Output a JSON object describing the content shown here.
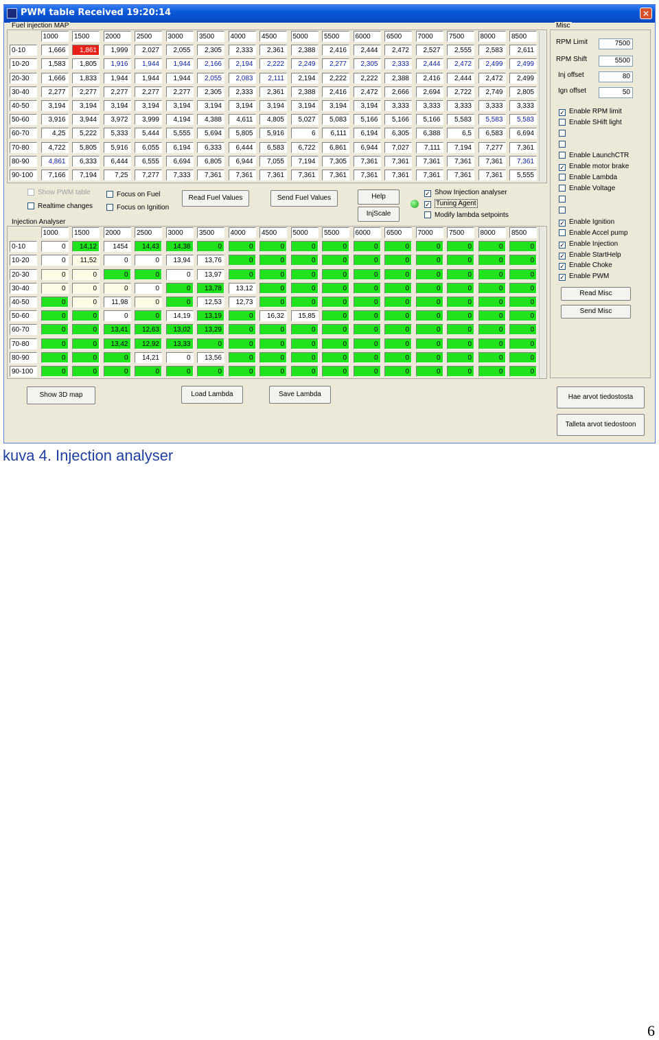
{
  "window": {
    "title": "PWM table Received 19:20:14"
  },
  "fuel_map": {
    "label": "Fuel injection MAP",
    "columns": [
      "1000",
      "1500",
      "2000",
      "2500",
      "3000",
      "3500",
      "4000",
      "4500",
      "5000",
      "5500",
      "6000",
      "6500",
      "7000",
      "7500",
      "8000",
      "8500"
    ],
    "rows": [
      {
        "label": "0-10",
        "values": [
          "1,666",
          "1,861",
          "1,999",
          "2,027",
          "2,055",
          "2,305",
          "2,333",
          "2,361",
          "2,388",
          "2,416",
          "2,444",
          "2,472",
          "2,527",
          "2,555",
          "2,583",
          "2,611"
        ],
        "red": [
          1
        ],
        "blue": []
      },
      {
        "label": "10-20",
        "values": [
          "1,583",
          "1,805",
          "1,916",
          "1,944",
          "1,944",
          "2,166",
          "2,194",
          "2,222",
          "2,249",
          "2,277",
          "2,305",
          "2,333",
          "2,444",
          "2,472",
          "2,499",
          "2,499"
        ],
        "red": [],
        "blue": [
          2,
          3,
          4,
          5,
          6,
          7,
          8,
          9,
          10,
          11,
          12,
          13,
          14,
          15
        ]
      },
      {
        "label": "20-30",
        "values": [
          "1,666",
          "1,833",
          "1,944",
          "1,944",
          "1,944",
          "2,055",
          "2,083",
          "2,111",
          "2,194",
          "2,222",
          "2,222",
          "2,388",
          "2,416",
          "2,444",
          "2,472",
          "2,499"
        ],
        "red": [],
        "blue": [
          5,
          6,
          7
        ]
      },
      {
        "label": "30-40",
        "values": [
          "2,277",
          "2,277",
          "2,277",
          "2,277",
          "2,277",
          "2,305",
          "2,333",
          "2,361",
          "2,388",
          "2,416",
          "2,472",
          "2,666",
          "2,694",
          "2,722",
          "2,749",
          "2,805"
        ],
        "red": [],
        "blue": []
      },
      {
        "label": "40-50",
        "values": [
          "3,194",
          "3,194",
          "3,194",
          "3,194",
          "3,194",
          "3,194",
          "3,194",
          "3,194",
          "3,194",
          "3,194",
          "3,194",
          "3,333",
          "3,333",
          "3,333",
          "3,333",
          "3,333"
        ],
        "red": [],
        "blue": []
      },
      {
        "label": "50-60",
        "values": [
          "3,916",
          "3,944",
          "3,972",
          "3,999",
          "4,194",
          "4,388",
          "4,611",
          "4,805",
          "5,027",
          "5,083",
          "5,166",
          "5,166",
          "5,166",
          "5,583",
          "5,583",
          "5,583"
        ],
        "red": [],
        "blue": [
          14,
          15
        ]
      },
      {
        "label": "60-70",
        "values": [
          "4,25",
          "5,222",
          "5,333",
          "5,444",
          "5,555",
          "5,694",
          "5,805",
          "5,916",
          "6",
          "6,111",
          "6,194",
          "6,305",
          "6,388",
          "6,5",
          "6,583",
          "6,694"
        ],
        "red": [],
        "blue": []
      },
      {
        "label": "70-80",
        "values": [
          "4,722",
          "5,805",
          "5,916",
          "6,055",
          "6,194",
          "6,333",
          "6,444",
          "6,583",
          "6,722",
          "6,861",
          "6,944",
          "7,027",
          "7,111",
          "7,194",
          "7,277",
          "7,361"
        ],
        "red": [],
        "blue": []
      },
      {
        "label": "80-90",
        "values": [
          "4,861",
          "6,333",
          "6,444",
          "6,555",
          "6,694",
          "6,805",
          "6,944",
          "7,055",
          "7,194",
          "7,305",
          "7,361",
          "7,361",
          "7,361",
          "7,361",
          "7,361",
          "7,361"
        ],
        "red": [],
        "blue": [
          0,
          15
        ]
      },
      {
        "label": "90-100",
        "values": [
          "7,166",
          "7,194",
          "7,25",
          "7,277",
          "7,333",
          "7,361",
          "7,361",
          "7,361",
          "7,361",
          "7,361",
          "7,361",
          "7,361",
          "7,361",
          "7,361",
          "7,361",
          "5,555"
        ],
        "red": [],
        "blue": []
      }
    ]
  },
  "options": {
    "show_pwm_table": "Show PWM table",
    "realtime_changes": "Realtime changes",
    "focus_on_fuel": "Focus on Fuel",
    "focus_on_ignition": "Focus on Ignition",
    "read_fuel_values": "Read Fuel Values",
    "send_fuel_values": "Send Fuel Values",
    "help": "Help",
    "injscale": "InjScale",
    "show_injection_analyser": "Show Injection analyser",
    "tuning_agent": "Tuning Agent",
    "modify_lambda": "Modify lambda setpoints"
  },
  "analyser": {
    "label": "Injection Analyser",
    "columns": [
      "1000",
      "1500",
      "2000",
      "2500",
      "3000",
      "3500",
      "4000",
      "4500",
      "5000",
      "5500",
      "6000",
      "6500",
      "7000",
      "7500",
      "8000",
      "8500"
    ],
    "rows": [
      {
        "label": "0-10",
        "values": [
          "0",
          "14,12",
          "1454",
          "14,43",
          "14,38",
          "0",
          "0",
          "0",
          "0",
          "0",
          "0",
          "0",
          "0",
          "0",
          "0",
          "0"
        ],
        "colors": [
          "w",
          "g",
          "w",
          "g",
          "g",
          "g",
          "g",
          "g",
          "g",
          "g",
          "g",
          "g",
          "g",
          "g",
          "g",
          "g"
        ]
      },
      {
        "label": "10-20",
        "values": [
          "0",
          "11,52",
          "0",
          "0",
          "13,94",
          "13,76",
          "0",
          "0",
          "0",
          "0",
          "0",
          "0",
          "0",
          "0",
          "0",
          "0"
        ],
        "colors": [
          "w",
          "p",
          "w",
          "w",
          "w",
          "w",
          "g",
          "g",
          "g",
          "g",
          "g",
          "g",
          "g",
          "g",
          "g",
          "g"
        ]
      },
      {
        "label": "20-30",
        "values": [
          "0",
          "0",
          "0",
          "0",
          "0",
          "13,97",
          "0",
          "0",
          "0",
          "0",
          "0",
          "0",
          "0",
          "0",
          "0",
          "0"
        ],
        "colors": [
          "p",
          "p",
          "g",
          "g",
          "w",
          "w",
          "g",
          "g",
          "g",
          "g",
          "g",
          "g",
          "g",
          "g",
          "g",
          "g"
        ]
      },
      {
        "label": "30-40",
        "values": [
          "0",
          "0",
          "0",
          "0",
          "0",
          "13,78",
          "13,12",
          "0",
          "0",
          "0",
          "0",
          "0",
          "0",
          "0",
          "0",
          "0"
        ],
        "colors": [
          "p",
          "p",
          "p",
          "w",
          "g",
          "g",
          "w",
          "g",
          "g",
          "g",
          "g",
          "g",
          "g",
          "g",
          "g",
          "g"
        ]
      },
      {
        "label": "40-50",
        "values": [
          "0",
          "0",
          "11,98",
          "0",
          "0",
          "12,53",
          "12,73",
          "0",
          "0",
          "0",
          "0",
          "0",
          "0",
          "0",
          "0",
          "0"
        ],
        "colors": [
          "g",
          "p",
          "w",
          "p",
          "g",
          "w",
          "w",
          "g",
          "g",
          "g",
          "g",
          "g",
          "g",
          "g",
          "g",
          "g"
        ]
      },
      {
        "label": "50-60",
        "values": [
          "0",
          "0",
          "0",
          "0",
          "14,19",
          "13,19",
          "0",
          "16,32",
          "15,85",
          "0",
          "0",
          "0",
          "0",
          "0",
          "0",
          "0"
        ],
        "colors": [
          "g",
          "g",
          "w",
          "g",
          "w",
          "g",
          "g",
          "w",
          "w",
          "g",
          "g",
          "g",
          "g",
          "g",
          "g",
          "g"
        ]
      },
      {
        "label": "60-70",
        "values": [
          "0",
          "0",
          "13,41",
          "12,63",
          "13,02",
          "13,29",
          "0",
          "0",
          "0",
          "0",
          "0",
          "0",
          "0",
          "0",
          "0",
          "0"
        ],
        "colors": [
          "g",
          "g",
          "g",
          "g",
          "g",
          "g",
          "g",
          "g",
          "g",
          "g",
          "g",
          "g",
          "g",
          "g",
          "g",
          "g"
        ]
      },
      {
        "label": "70-80",
        "values": [
          "0",
          "0",
          "13,42",
          "12,92",
          "13,33",
          "0",
          "0",
          "0",
          "0",
          "0",
          "0",
          "0",
          "0",
          "0",
          "0",
          "0"
        ],
        "colors": [
          "g",
          "g",
          "g",
          "g",
          "g",
          "g",
          "g",
          "g",
          "g",
          "g",
          "g",
          "g",
          "g",
          "g",
          "g",
          "g"
        ]
      },
      {
        "label": "80-90",
        "values": [
          "0",
          "0",
          "0",
          "14,21",
          "0",
          "13,56",
          "0",
          "0",
          "0",
          "0",
          "0",
          "0",
          "0",
          "0",
          "0",
          "0"
        ],
        "colors": [
          "g",
          "g",
          "g",
          "w",
          "w",
          "w",
          "g",
          "g",
          "g",
          "g",
          "g",
          "g",
          "g",
          "g",
          "g",
          "g"
        ]
      },
      {
        "label": "90-100",
        "values": [
          "0",
          "0",
          "0",
          "0",
          "0",
          "0",
          "0",
          "0",
          "0",
          "0",
          "0",
          "0",
          "0",
          "0",
          "0",
          "0"
        ],
        "colors": [
          "g",
          "g",
          "g",
          "g",
          "g",
          "g",
          "g",
          "g",
          "g",
          "g",
          "g",
          "g",
          "g",
          "g",
          "g",
          "g"
        ]
      }
    ]
  },
  "bottom_buttons": {
    "show_3d_map": "Show 3D map",
    "load_lambda": "Load Lambda",
    "save_lambda": "Save Lambda",
    "load_from_file": "Hae arvot tiedostosta",
    "save_to_file": "Talleta arvot tiedostoon"
  },
  "misc": {
    "label": "Misc",
    "rpm_limit_label": "RPM Limit",
    "rpm_limit_value": "7500",
    "rpm_shift_label": "RPM Shift",
    "rpm_shift_value": "5500",
    "inj_offset_label": "Inj offset",
    "inj_offset_value": "80",
    "ign_offset_label": "Ign offset",
    "ign_offset_value": "50",
    "checkboxes": [
      {
        "label": "Enable RPM limit",
        "checked": true
      },
      {
        "label": "Enable SHift light",
        "checked": false
      },
      {
        "label": "",
        "checked": false
      },
      {
        "label": "",
        "checked": false
      },
      {
        "label": "Enable LaunchCTR",
        "checked": false
      },
      {
        "label": "Enable motor brake",
        "checked": true
      },
      {
        "label": "Enable Lambda",
        "checked": false
      },
      {
        "label": "Enable Voltage",
        "checked": false
      },
      {
        "label": "",
        "checked": false
      },
      {
        "label": "",
        "checked": false
      },
      {
        "label": "Enable Ignition",
        "checked": true
      },
      {
        "label": "Enable Accel pump",
        "checked": false
      },
      {
        "label": "Enable Injection",
        "checked": true
      },
      {
        "label": "Enable StartHelp",
        "checked": true
      },
      {
        "label": "Enable Choke",
        "checked": true
      },
      {
        "label": "Enable PWM",
        "checked": true
      }
    ],
    "read_misc": "Read Misc",
    "send_misc": "Send Misc"
  },
  "caption": "kuva 4. Injection analyser",
  "page_number": "6"
}
